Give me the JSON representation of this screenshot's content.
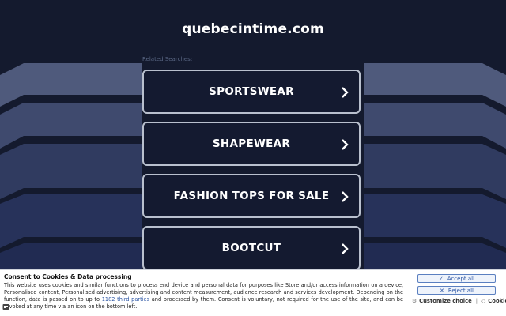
{
  "header": {
    "domain": "quebecintime.com"
  },
  "related": {
    "label": "Related Searches:",
    "items": [
      {
        "label": "SPORTSWEAR"
      },
      {
        "label": "SHAPEWEAR"
      },
      {
        "label": "FASHION TOPS FOR SALE"
      },
      {
        "label": "BOOTCUT"
      }
    ]
  },
  "consent": {
    "title": "Consent to Cookies & Data processing",
    "text_before_link": "This website uses cookies and similar functions to process end device and personal data for purposes like Store and/or access information on a device, Personalised content, Personalised advertising, advertising and content measurement, audience research and services development. Depending on the function, data is passed on to up to ",
    "link_text": "1182 third parties",
    "text_after_link": " and processed by them. Consent is voluntary, not required for the use of the site, and can be revoked at any time via an icon on the bottom left.",
    "accept_label": "Accept all",
    "reject_label": "Reject all",
    "customize_label": "Customize choice",
    "cookies_label": "Cookies"
  },
  "colors": {
    "background": "#141a2e",
    "tile_border": "#b9c0ce",
    "link": "#2d56a4"
  }
}
